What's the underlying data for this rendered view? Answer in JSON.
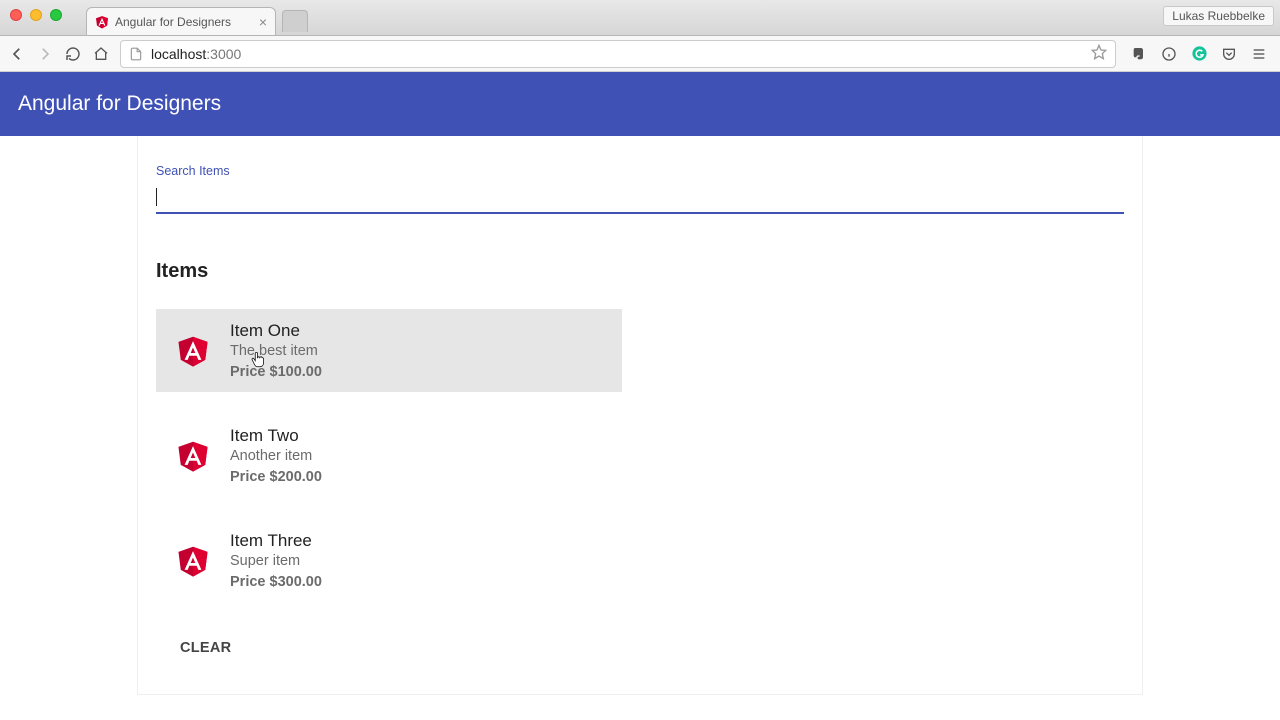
{
  "browser": {
    "tab_title": "Angular for Designers",
    "user_name": "Lukas Ruebbelke",
    "url_host": "localhost",
    "url_port": ":3000"
  },
  "app": {
    "title": "Angular for Designers"
  },
  "search": {
    "label": "Search Items",
    "value": ""
  },
  "list": {
    "heading": "Items",
    "items": [
      {
        "name": "Item One",
        "desc": "The best item",
        "price": "Price $100.00",
        "hover": true
      },
      {
        "name": "Item Two",
        "desc": "Another item",
        "price": "Price $200.00",
        "hover": false
      },
      {
        "name": "Item Three",
        "desc": "Super item",
        "price": "Price $300.00",
        "hover": false
      }
    ],
    "clear_label": "CLEAR"
  },
  "colors": {
    "primary": "#3f51b5",
    "angular_red": "#c3002f"
  }
}
